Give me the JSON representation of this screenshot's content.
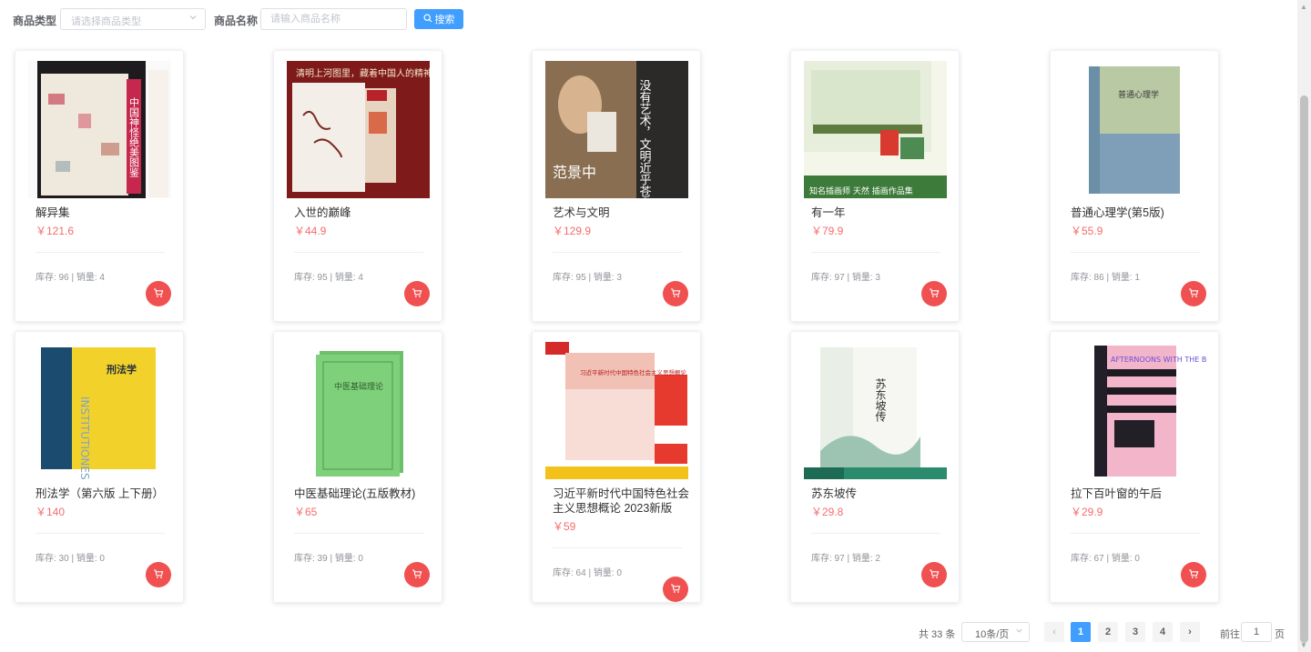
{
  "filter": {
    "type_label": "商品类型",
    "type_placeholder": "请选择商品类型",
    "name_label": "商品名称",
    "name_placeholder": "请输入商品名称",
    "search_label": "搜索"
  },
  "products": [
    {
      "name": "解异集",
      "price": "￥121.6",
      "stock": "库存: 96 | 销量: 4",
      "cover_text": "中国神怪绝美图鉴"
    },
    {
      "name": "入世的巅峰",
      "price": "￥44.9",
      "stock": "库存: 95 | 销量: 4",
      "cover_text": "清明上河图里，藏着中国人的精神"
    },
    {
      "name": "艺术与文明",
      "price": "￥129.9",
      "stock": "库存: 95 | 销量: 3",
      "cover_text": "没有艺术，文明近乎苍白。"
    },
    {
      "name": "有一年",
      "price": "￥79.9",
      "stock": "库存: 97 | 销量: 3",
      "cover_text": "知名插画师 天然 插画作品集"
    },
    {
      "name": "普通心理学(第5版)",
      "price": "￥55.9",
      "stock": "库存: 86 | 销量: 1",
      "cover_text": "普通心理学"
    },
    {
      "name": "刑法学（第六版 上下册）",
      "price": "￥140",
      "stock": "库存: 30 | 销量: 0",
      "cover_text": "刑法学"
    },
    {
      "name": "中医基础理论(五版教材)",
      "price": "￥65",
      "stock": "库存: 39 | 销量: 0",
      "cover_text": "中医基础理论"
    },
    {
      "name": "习近平新时代中国特色社会主义思想概论 2023新版",
      "price": "￥59",
      "stock": "库存: 64 | 销量: 0",
      "cover_text": "习近平新时代中国特色社会主义思想概论"
    },
    {
      "name": "苏东坡传",
      "price": "￥29.8",
      "stock": "库存: 97 | 销量: 2",
      "cover_text": "苏东坡传"
    },
    {
      "name": "拉下百叶窗的午后",
      "price": "￥29.9",
      "stock": "库存: 67 | 销量: 0",
      "cover_text": "AFTERNOONS WITH THE BLINDS DRAWN"
    }
  ],
  "pagination": {
    "total": "共 33 条",
    "page_size": "10条/页",
    "prev": "‹",
    "next": "›",
    "pages": [
      "1",
      "2",
      "3",
      "4"
    ],
    "current": "1",
    "goto_label": "前往",
    "goto_value": "1",
    "page_unit": "页"
  },
  "icons": {
    "search": "search-icon",
    "cart": "cart-icon",
    "select_arrow": "chevron-down-icon"
  },
  "colors": {
    "primary": "#409eff",
    "price": "#f56c6c",
    "cart": "#f05050"
  }
}
